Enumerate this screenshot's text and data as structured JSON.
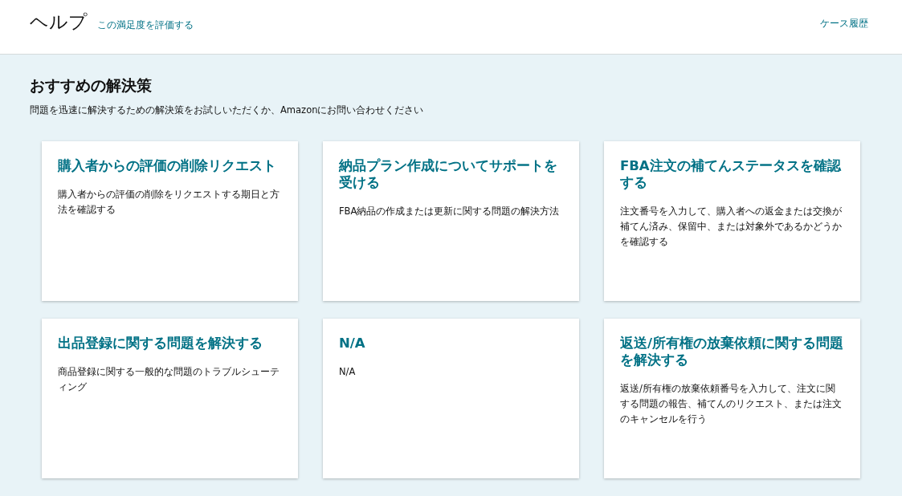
{
  "header": {
    "title": "ヘルプ",
    "rating_link": "この満足度を評価する",
    "history_link": "ケース履歴"
  },
  "section": {
    "title": "おすすめの解決策",
    "subtitle": "問題を迅速に解決するための解決策をお試しいただくか、Amazonにお問い合わせください"
  },
  "cards": [
    {
      "title": "購入者からの評価の削除リクエスト",
      "description": "購入者からの評価の削除をリクエストする期日と方法を確認する"
    },
    {
      "title": "納品プラン作成についてサポートを受ける",
      "description": "FBA納品の作成または更新に関する問題の解決方法"
    },
    {
      "title": "FBA注文の補てんステータスを確認する",
      "description": "注文番号を入力して、購入者への返金または交換が補てん済み、保留中、または対象外であるかどうかを確認する"
    },
    {
      "title": "出品登録に関する問題を解決する",
      "description": "商品登録に関する一般的な問題のトラブルシューティング"
    },
    {
      "title": "N/A",
      "description": "N/A"
    },
    {
      "title": "返送/所有権の放棄依頼に関する問題を解決する",
      "description": "返送/所有権の放棄依頼番号を入力して、注文に関する問題の報告、補てんのリクエスト、または注文のキャンセルを行う"
    }
  ]
}
